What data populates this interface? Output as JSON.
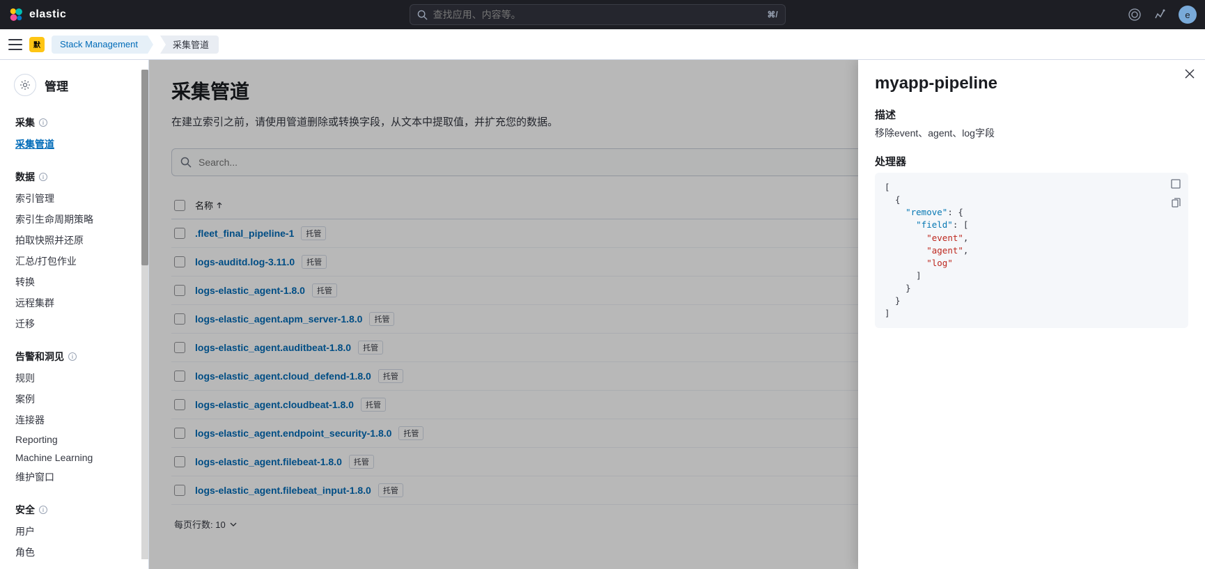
{
  "header": {
    "brand": "elastic",
    "search_placeholder": "查找应用、内容等。",
    "kbd_hint": "⌘/",
    "avatar_letter": "e"
  },
  "breadcrumb": {
    "deploy_badge": "默",
    "items": [
      "Stack Management",
      "采集管道"
    ]
  },
  "sidebar": {
    "header": "管理",
    "groups": [
      {
        "title": "采集",
        "info": true,
        "items": [
          {
            "label": "采集管道",
            "active": true
          }
        ]
      },
      {
        "title": "数据",
        "info": true,
        "items": [
          {
            "label": "索引管理"
          },
          {
            "label": "索引生命周期策略"
          },
          {
            "label": "拍取快照并还原"
          },
          {
            "label": "汇总/打包作业"
          },
          {
            "label": "转换"
          },
          {
            "label": "远程集群"
          },
          {
            "label": "迁移"
          }
        ]
      },
      {
        "title": "告警和洞见",
        "info": true,
        "items": [
          {
            "label": "规则"
          },
          {
            "label": "案例"
          },
          {
            "label": "连接器"
          },
          {
            "label": "Reporting"
          },
          {
            "label": "Machine Learning"
          },
          {
            "label": "维护窗口"
          }
        ]
      },
      {
        "title": "安全",
        "info": true,
        "items": [
          {
            "label": "用户"
          },
          {
            "label": "角色"
          }
        ]
      }
    ]
  },
  "main": {
    "title": "采集管道",
    "description": "在建立索引之前，请使用管道删除或转换字段，从文本中提取值，并扩充您的数据。",
    "search_placeholder": "Search...",
    "column_name": "名称",
    "badge_managed": "托管",
    "pipelines": [
      ".fleet_final_pipeline-1",
      "logs-auditd.log-3.11.0",
      "logs-elastic_agent-1.8.0",
      "logs-elastic_agent.apm_server-1.8.0",
      "logs-elastic_agent.auditbeat-1.8.0",
      "logs-elastic_agent.cloud_defend-1.8.0",
      "logs-elastic_agent.cloudbeat-1.8.0",
      "logs-elastic_agent.endpoint_security-1.8.0",
      "logs-elastic_agent.filebeat-1.8.0",
      "logs-elastic_agent.filebeat_input-1.8.0"
    ],
    "pagination_label": "每页行数: 10"
  },
  "flyout": {
    "title": "myapp-pipeline",
    "desc_heading": "描述",
    "desc_text": "移除event、agent、log字段",
    "proc_heading": "处理器",
    "code": {
      "remove_key": "\"remove\"",
      "field_key": "\"field\"",
      "vals": [
        "\"event\"",
        "\"agent\"",
        "\"log\""
      ]
    }
  }
}
